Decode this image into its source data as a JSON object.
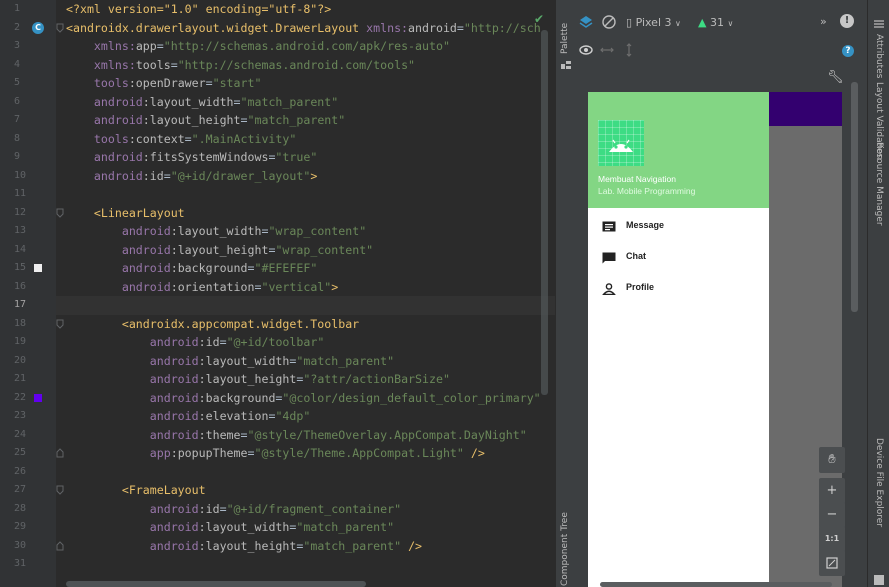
{
  "editor": {
    "line_numbers": [
      "1",
      "2",
      "3",
      "4",
      "5",
      "6",
      "7",
      "8",
      "9",
      "10",
      "11",
      "12",
      "13",
      "14",
      "15",
      "16",
      "17",
      "18",
      "19",
      "20",
      "21",
      "22",
      "23",
      "24",
      "25",
      "26",
      "27",
      "28",
      "29",
      "30",
      "31"
    ],
    "current_line_index": 16,
    "lines": [
      [
        [
          "pi",
          "<?xml version=\"1.0\" encoding=\"utf-8\"?>"
        ]
      ],
      [
        [
          "tag",
          "<androidx.drawerlayout.widget.DrawerLayout "
        ],
        [
          "ns",
          "xmlns:"
        ],
        [
          "attr",
          "android"
        ],
        [
          "plain",
          "="
        ],
        [
          "val",
          "\"http://sch"
        ]
      ],
      [
        [
          "plain",
          "    "
        ],
        [
          "ns",
          "xmlns:"
        ],
        [
          "attr",
          "app"
        ],
        [
          "plain",
          "="
        ],
        [
          "val",
          "\"http://schemas.android.com/apk/res-auto\""
        ]
      ],
      [
        [
          "plain",
          "    "
        ],
        [
          "ns",
          "xmlns:"
        ],
        [
          "attr",
          "tools"
        ],
        [
          "plain",
          "="
        ],
        [
          "val",
          "\"http://schemas.android.com/tools\""
        ]
      ],
      [
        [
          "plain",
          "    "
        ],
        [
          "ns",
          "tools"
        ],
        [
          "attr",
          ":openDrawer"
        ],
        [
          "plain",
          "="
        ],
        [
          "val",
          "\"start\""
        ]
      ],
      [
        [
          "plain",
          "    "
        ],
        [
          "ns",
          "android"
        ],
        [
          "attr",
          ":layout_width"
        ],
        [
          "plain",
          "="
        ],
        [
          "val",
          "\"match_parent\""
        ]
      ],
      [
        [
          "plain",
          "    "
        ],
        [
          "ns",
          "android"
        ],
        [
          "attr",
          ":layout_height"
        ],
        [
          "plain",
          "="
        ],
        [
          "val",
          "\"match_parent\""
        ]
      ],
      [
        [
          "plain",
          "    "
        ],
        [
          "ns",
          "tools"
        ],
        [
          "attr",
          ":context"
        ],
        [
          "plain",
          "="
        ],
        [
          "val",
          "\".MainActivity\""
        ]
      ],
      [
        [
          "plain",
          "    "
        ],
        [
          "ns",
          "android"
        ],
        [
          "attr",
          ":fitsSystemWindows"
        ],
        [
          "plain",
          "="
        ],
        [
          "val",
          "\"true\""
        ]
      ],
      [
        [
          "plain",
          "    "
        ],
        [
          "ns",
          "android"
        ],
        [
          "attr",
          ":id"
        ],
        [
          "plain",
          "="
        ],
        [
          "val",
          "\"@+id/drawer_layout\""
        ],
        [
          "tag",
          ">"
        ]
      ],
      [
        [
          "plain",
          ""
        ]
      ],
      [
        [
          "plain",
          "    "
        ],
        [
          "tag",
          "<LinearLayout"
        ]
      ],
      [
        [
          "plain",
          "        "
        ],
        [
          "ns",
          "android"
        ],
        [
          "attr",
          ":layout_width"
        ],
        [
          "plain",
          "="
        ],
        [
          "val",
          "\"wrap_content\""
        ]
      ],
      [
        [
          "plain",
          "        "
        ],
        [
          "ns",
          "android"
        ],
        [
          "attr",
          ":layout_height"
        ],
        [
          "plain",
          "="
        ],
        [
          "val",
          "\"wrap_content\""
        ]
      ],
      [
        [
          "plain",
          "        "
        ],
        [
          "ns",
          "android"
        ],
        [
          "attr",
          ":background"
        ],
        [
          "plain",
          "="
        ],
        [
          "val",
          "\"#EFEFEF\""
        ]
      ],
      [
        [
          "plain",
          "        "
        ],
        [
          "ns",
          "android"
        ],
        [
          "attr",
          ":orientation"
        ],
        [
          "plain",
          "="
        ],
        [
          "val",
          "\"vertical\""
        ],
        [
          "tag",
          ">"
        ]
      ],
      [
        [
          "plain",
          ""
        ]
      ],
      [
        [
          "plain",
          "        "
        ],
        [
          "tag",
          "<androidx.appcompat.widget.Toolbar"
        ]
      ],
      [
        [
          "plain",
          "            "
        ],
        [
          "ns",
          "android"
        ],
        [
          "attr",
          ":id"
        ],
        [
          "plain",
          "="
        ],
        [
          "val",
          "\"@+id/toolbar\""
        ]
      ],
      [
        [
          "plain",
          "            "
        ],
        [
          "ns",
          "android"
        ],
        [
          "attr",
          ":layout_width"
        ],
        [
          "plain",
          "="
        ],
        [
          "val",
          "\"match_parent\""
        ]
      ],
      [
        [
          "plain",
          "            "
        ],
        [
          "ns",
          "android"
        ],
        [
          "attr",
          ":layout_height"
        ],
        [
          "plain",
          "="
        ],
        [
          "val",
          "\"?attr/actionBarSize\""
        ]
      ],
      [
        [
          "plain",
          "            "
        ],
        [
          "ns",
          "android"
        ],
        [
          "attr",
          ":background"
        ],
        [
          "plain",
          "="
        ],
        [
          "val",
          "\"@color/design_default_color_primary\""
        ]
      ],
      [
        [
          "plain",
          "            "
        ],
        [
          "ns",
          "android"
        ],
        [
          "attr",
          ":elevation"
        ],
        [
          "plain",
          "="
        ],
        [
          "val",
          "\"4dp\""
        ]
      ],
      [
        [
          "plain",
          "            "
        ],
        [
          "ns",
          "android"
        ],
        [
          "attr",
          ":theme"
        ],
        [
          "plain",
          "="
        ],
        [
          "val",
          "\"@style/ThemeOverlay.AppCompat.DayNight\""
        ]
      ],
      [
        [
          "plain",
          "            "
        ],
        [
          "ns",
          "app"
        ],
        [
          "attr",
          ":popupTheme"
        ],
        [
          "plain",
          "="
        ],
        [
          "val",
          "\"@style/Theme.AppCompat.Light\""
        ],
        [
          "tag",
          " />"
        ]
      ],
      [
        [
          "plain",
          ""
        ]
      ],
      [
        [
          "plain",
          "        "
        ],
        [
          "tag",
          "<FrameLayout"
        ]
      ],
      [
        [
          "plain",
          "            "
        ],
        [
          "ns",
          "android"
        ],
        [
          "attr",
          ":id"
        ],
        [
          "plain",
          "="
        ],
        [
          "val",
          "\"@+id/fragment_container\""
        ]
      ],
      [
        [
          "plain",
          "            "
        ],
        [
          "ns",
          "android"
        ],
        [
          "attr",
          ":layout_width"
        ],
        [
          "plain",
          "="
        ],
        [
          "val",
          "\"match_parent\""
        ]
      ],
      [
        [
          "plain",
          "            "
        ],
        [
          "ns",
          "android"
        ],
        [
          "attr",
          ":layout_height"
        ],
        [
          "plain",
          "="
        ],
        [
          "val",
          "\"match_parent\""
        ],
        [
          "tag",
          " />"
        ]
      ],
      [
        [
          "plain",
          ""
        ]
      ]
    ],
    "gutter_colors": {
      "line_15": "#EFEFEF",
      "line_22": "#6200EE"
    },
    "gutter_badge_line": 2
  },
  "side_tabs": {
    "palette": "Palette",
    "component_tree": "Component Tree",
    "attributes": "Attributes",
    "layout_validation": "Layout Validation",
    "resource_manager": "Resource Manager",
    "device_file_explorer": "Device File Explorer"
  },
  "preview": {
    "device": "Pixel 3",
    "api": "31",
    "more": "»",
    "zoom_one_to_one": "1:1",
    "zoom_in": "+",
    "zoom_out": "−"
  },
  "drawer": {
    "title": "Membuat Navigation",
    "subtitle": "Lab. Mobile Programming",
    "menu": [
      {
        "label": "Message",
        "icon": "message-icon"
      },
      {
        "label": "Chat",
        "icon": "chat-icon"
      },
      {
        "label": "Profile",
        "icon": "profile-icon"
      }
    ],
    "header_color": "#83D684",
    "toolbar_color": "#33006F"
  }
}
